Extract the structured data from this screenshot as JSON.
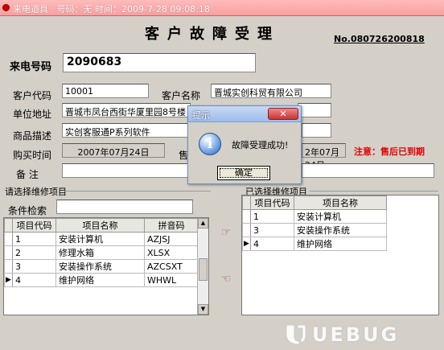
{
  "window": {
    "title": "来电道具  · 号码：无  时间：2009-7-28 09:08:18"
  },
  "header": {
    "title": "客户故障受理",
    "order_no": "No.080726200818"
  },
  "caller": {
    "label": "来电号码",
    "value": "2090683"
  },
  "customer": {
    "code_label": "客户代码",
    "code_value": "10001",
    "name_label": "客户名称",
    "name_value": "晋城实创科贸有限公司",
    "address_label": "单位地址",
    "address_value": "晋城市凤台西街华厦里园8号楼",
    "product_label": "商品描述",
    "product_value": "实创客服通P系列软件",
    "purchase_label": "购买时间",
    "purchase_value": "2007年07月24日",
    "purchase_label2": "售",
    "purchase_value2": "2年07月24日",
    "remark_label": "备  注",
    "remark_value": "",
    "notice": "注意：售后已到期"
  },
  "left_panel": {
    "group_label": "请选择维修项目",
    "filter_label": "条件检索",
    "filter_value": "",
    "columns": [
      "项目代码",
      "项目名称",
      "拼音码"
    ],
    "rows": [
      {
        "code": "1",
        "name": "安装计算机",
        "py": "AZJSJ",
        "current": false
      },
      {
        "code": "2",
        "name": "修理水箱",
        "py": "XLSX",
        "current": false
      },
      {
        "code": "3",
        "name": "安装操作系统",
        "py": "AZCSXT",
        "current": false
      },
      {
        "code": "4",
        "name": "维护网络",
        "py": "WHWL",
        "current": true
      }
    ]
  },
  "right_panel": {
    "group_label": "已选择维修项目",
    "columns": [
      "项目代码",
      "项目名称"
    ],
    "rows": [
      {
        "code": "1",
        "name": "安装计算机",
        "current": false
      },
      {
        "code": "3",
        "name": "安装操作系统",
        "current": false
      },
      {
        "code": "4",
        "name": "维护网络",
        "current": true
      }
    ]
  },
  "icons": {
    "add": "hand-right-icon",
    "remove": "hand-left-icon"
  },
  "dialog": {
    "title": "提示",
    "close": "✕",
    "message": "故障受理成功!",
    "ok": "确定"
  },
  "watermark": "UEBUG"
}
